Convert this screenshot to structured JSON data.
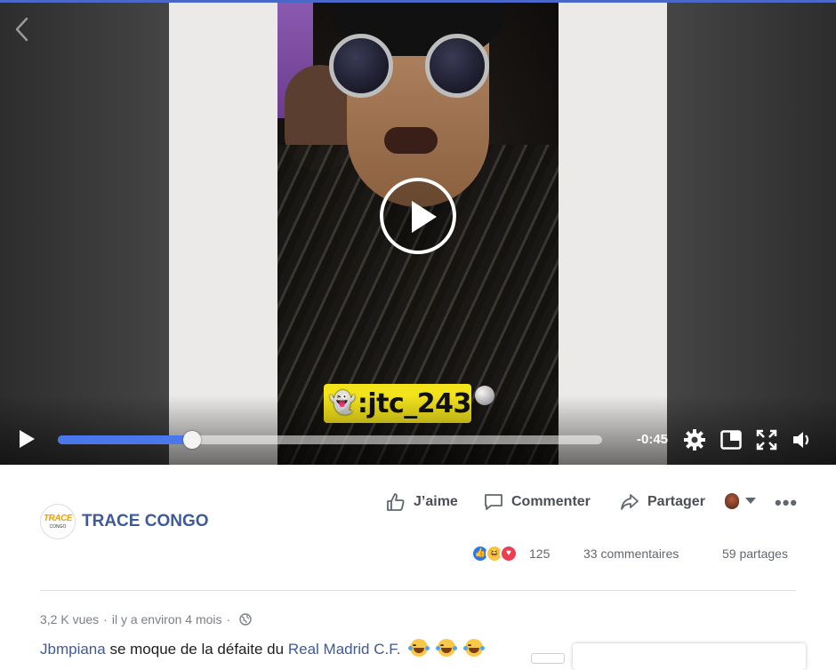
{
  "player": {
    "overlay_handle": ":jtc_243",
    "remaining_time": "-0:45",
    "progress_fraction": 0.247,
    "accent_color": "#4a78ea",
    "icons": [
      "chevron-left-icon",
      "play-icon",
      "gear-icon",
      "picture-in-picture-icon",
      "fullscreen-icon",
      "volume-icon"
    ]
  },
  "post": {
    "page_name": "TRACE CONGO",
    "logo_text": "TRACE",
    "logo_subtext": "CONGO",
    "actions": {
      "like": "J’aime",
      "comment": "Commenter",
      "share": "Partager"
    },
    "reactions": {
      "types": [
        "like",
        "haha",
        "love"
      ],
      "count": "125"
    },
    "comments_count": "33 commentaires",
    "shares_count": "59 partages",
    "views": "3,2 K vues",
    "separator": "·",
    "time_ago": "il y a environ 4 mois",
    "description": {
      "mention": "Jbmpiana",
      "text": "se moque de la défaite du",
      "team": "Real Madrid C.F."
    },
    "brand_color": "#3f5a9a"
  }
}
